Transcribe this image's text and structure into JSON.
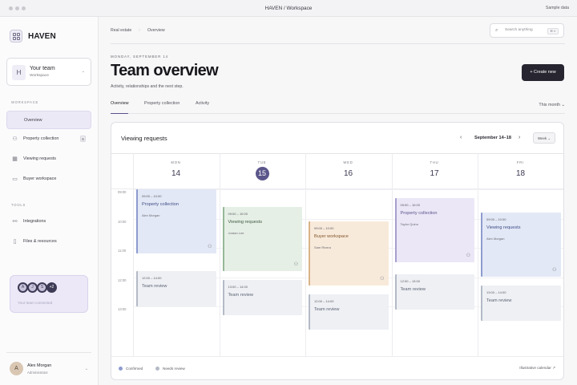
{
  "window": {
    "title": "HAVEN / Workspace",
    "right_label": "Sample data"
  },
  "brand": {
    "name": "HAVEN",
    "icon": "grid-logo-icon"
  },
  "team": {
    "avatar": "H",
    "name": "Your team",
    "sub": "Workspace"
  },
  "sidebar": {
    "workspace_label": "WORKSPACE",
    "items": [
      {
        "label": "Overview",
        "icon": "home-icon",
        "active": true
      },
      {
        "label": "Property collection",
        "icon": "users-icon",
        "badge": "6"
      },
      {
        "label": "Viewing requests",
        "icon": "calendar-icon"
      },
      {
        "label": "Buyer workspace",
        "icon": "chat-icon"
      }
    ],
    "tools_label": "TOOLS",
    "tools": [
      {
        "label": "Integrations",
        "icon": "integrations-icon"
      },
      {
        "label": "Files & resources",
        "icon": "file-icon"
      }
    ],
    "connected": {
      "avatars": [
        "A",
        "J",
        "S"
      ],
      "more": "+2",
      "text": "Your team connected"
    }
  },
  "user": {
    "avatar": "A",
    "name": "Alex Morgan",
    "role": "Administrator"
  },
  "breadcrumb": {
    "root": "Real estate",
    "current": "Overview"
  },
  "search": {
    "placeholder": "Search anything",
    "shortcut": "⌘ K"
  },
  "header": {
    "date": "MONDAY, SEPTEMBER 14",
    "title": "Team overview",
    "subtitle": "Activity, relationships and the next step.",
    "create_label": "+ Create new"
  },
  "tabs": [
    "Overview",
    "Property collection",
    "Activity"
  ],
  "period": "This month ⌄",
  "calendar": {
    "title": "Viewing requests",
    "range": "September 14–18",
    "view": "Week ⌄",
    "days": [
      {
        "name": "MON",
        "num": "14"
      },
      {
        "name": "TUE",
        "num": "15",
        "today": true
      },
      {
        "name": "WED",
        "num": "16"
      },
      {
        "name": "THU",
        "num": "17"
      },
      {
        "name": "FRI",
        "num": "18"
      }
    ],
    "times": [
      "09:00",
      "10:00",
      "11:00",
      "12:00",
      "13:00"
    ],
    "events": [
      {
        "day": 0,
        "start": 9.0,
        "end": 11.2,
        "time": "09:00 – 10:00",
        "title": "Property collection",
        "person": "Alex Morgan",
        "color": "blue",
        "icon": true
      },
      {
        "day": 0,
        "start": 11.8,
        "end": 13.0,
        "time": "12:00 – 14:00",
        "title": "Team review",
        "color": "gray"
      },
      {
        "day": 1,
        "start": 9.6,
        "end": 11.8,
        "time": "09:00 – 10:00",
        "title": "Viewing requests",
        "person": "Jordan Lee",
        "color": "green",
        "icon": true
      },
      {
        "day": 1,
        "start": 12.1,
        "end": 13.3,
        "time": "13:00 – 14:00",
        "title": "Team review",
        "color": "gray"
      },
      {
        "day": 2,
        "start": 10.1,
        "end": 12.3,
        "time": "09:00 – 10:00",
        "title": "Buyer workspace",
        "person": "Sam Rivera",
        "color": "orange",
        "icon": true
      },
      {
        "day": 2,
        "start": 12.6,
        "end": 13.8,
        "time": "12:00 – 14:00",
        "title": "Team review",
        "color": "gray"
      },
      {
        "day": 3,
        "start": 9.3,
        "end": 11.5,
        "time": "09:00 – 10:00",
        "title": "Property collection",
        "person": "Taylor Quinn",
        "color": "purple",
        "icon": true
      },
      {
        "day": 3,
        "start": 11.9,
        "end": 13.1,
        "time": "12:00 – 13:00",
        "title": "Team review",
        "color": "gray"
      },
      {
        "day": 4,
        "start": 9.8,
        "end": 12.0,
        "time": "09:00 – 10:00",
        "title": "Viewing requests",
        "person": "Alex Morgan",
        "color": "blue",
        "icon": true
      },
      {
        "day": 4,
        "start": 12.3,
        "end": 13.5,
        "time": "13:00 – 14:00",
        "title": "Team review",
        "color": "gray"
      }
    ],
    "legend": [
      {
        "label": "Confirmed",
        "color": "#8d9bcf"
      },
      {
        "label": "Needs review",
        "color": "#b4bac6"
      }
    ],
    "footer_link": "Illustrative calendar ↗"
  }
}
